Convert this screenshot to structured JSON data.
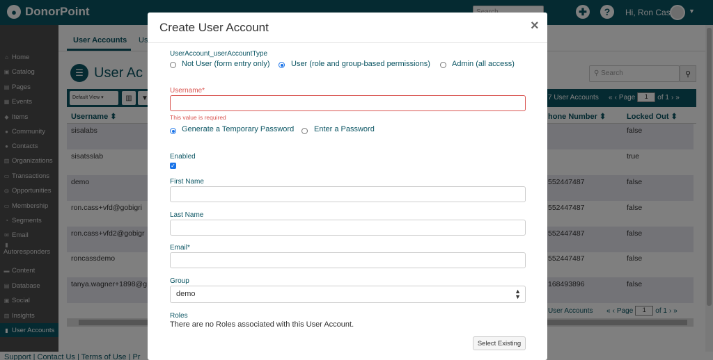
{
  "app": {
    "name": "DonorPoint"
  },
  "topbar": {
    "search_placeholder": "Search",
    "greeting": "Hi, Ron Cass"
  },
  "sidebar": {
    "items": [
      {
        "label": "Home",
        "icon": "home-icon"
      },
      {
        "label": "Catalog",
        "icon": "cart-icon"
      },
      {
        "label": "Pages",
        "icon": "pages-icon"
      },
      {
        "label": "Events",
        "icon": "calendar-icon"
      },
      {
        "label": "Items",
        "icon": "tag-icon"
      },
      {
        "label": "Community",
        "icon": "community-icon"
      },
      {
        "label": "Contacts",
        "icon": "person-icon"
      },
      {
        "label": "Organizations",
        "icon": "building-icon"
      },
      {
        "label": "Transactions",
        "icon": "money-icon"
      },
      {
        "label": "Opportunities",
        "icon": "target-icon"
      },
      {
        "label": "Membership",
        "icon": "card-icon"
      },
      {
        "label": "Segments",
        "icon": "pie-icon"
      },
      {
        "label": "Email",
        "icon": "envelope-icon"
      },
      {
        "label": "Autoresponders",
        "icon": "book-icon"
      },
      {
        "label": "Content",
        "icon": "folder-icon"
      },
      {
        "label": "Database",
        "icon": "database-icon"
      },
      {
        "label": "Social",
        "icon": "social-icon"
      },
      {
        "label": "Insights",
        "icon": "chart-icon"
      },
      {
        "label": "User Accounts",
        "icon": "user-account-icon"
      }
    ]
  },
  "page": {
    "tabs": [
      "User Accounts",
      "Us"
    ],
    "title": "User Ac",
    "search_placeholder": "Search",
    "view_select": "Default View",
    "record_count": "7 User Accounts",
    "record_count_bottom": "User Accounts",
    "pager": {
      "page_label": "Page",
      "page_value": "1",
      "of_label": "of 1"
    },
    "columns": [
      "Username",
      "hone Number",
      "Locked Out"
    ],
    "rows": [
      {
        "username": "sisalabs",
        "phone": "",
        "locked": "false"
      },
      {
        "username": "sisatsslab",
        "phone": "",
        "locked": "true"
      },
      {
        "username": "demo",
        "phone": "552447487",
        "locked": "false"
      },
      {
        "username": "ron.cass+vfd@gobigri",
        "phone": "552447487",
        "locked": "false"
      },
      {
        "username": "ron.cass+vfd2@gobigr",
        "phone": "552447487",
        "locked": "false"
      },
      {
        "username": "roncassdemo",
        "phone": "552447487",
        "locked": "false"
      },
      {
        "username": "tanya.wagner+1898@g",
        "phone": "168493896",
        "locked": "false"
      }
    ]
  },
  "footer": {
    "links": "Support | Contact Us | Terms of Use | Pr"
  },
  "modal": {
    "title": "Create User Account",
    "close": "×",
    "account_type": {
      "label": "UserAccount_userAccountType",
      "options": [
        "Not User (form entry only)",
        "User (role and group-based permissions)",
        "Admin (all access)"
      ],
      "selected": 1
    },
    "username": {
      "label": "Username*",
      "value": "",
      "error": "This value is required"
    },
    "password_mode": {
      "options": [
        "Generate a Temporary Password",
        "Enter a Password"
      ],
      "selected": 0
    },
    "enabled": {
      "label": "Enabled",
      "checked": true
    },
    "first_name": {
      "label": "First Name",
      "value": ""
    },
    "last_name": {
      "label": "Last Name",
      "value": ""
    },
    "email": {
      "label": "Email*",
      "value": ""
    },
    "group": {
      "label": "Group",
      "value": "demo"
    },
    "roles": {
      "label": "Roles",
      "empty_text": "There are no Roles associated with this User Account.",
      "button": "Select Existing"
    }
  }
}
